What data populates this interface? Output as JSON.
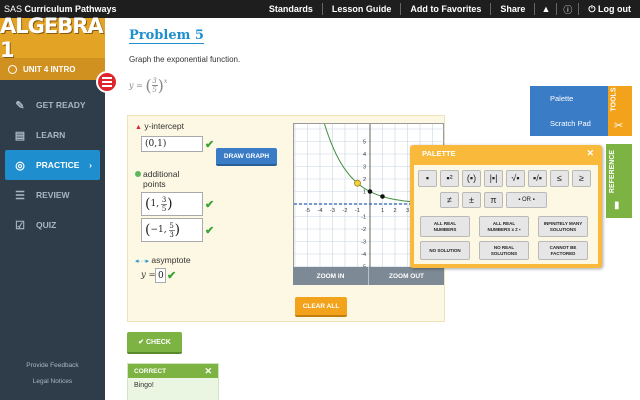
{
  "topbar": {
    "brand_prefix": "SAS",
    "brand_name": "Curriculum Pathways",
    "links": [
      "Standards",
      "Lesson Guide",
      "Add to Favorites",
      "Share"
    ],
    "warning_icon": "warning-icon",
    "info_icon": "info-icon",
    "logout": "Log out"
  },
  "sidebar": {
    "logo": "ALGEBRA 1",
    "unit": "UNIT 4  INTRO",
    "items": [
      {
        "label": "GET READY",
        "icon": "pencil-icon"
      },
      {
        "label": "LEARN",
        "icon": "book-icon"
      },
      {
        "label": "PRACTICE",
        "icon": "target-icon"
      },
      {
        "label": "REVIEW",
        "icon": "list-icon"
      },
      {
        "label": "QUIZ",
        "icon": "checkbox-icon"
      }
    ],
    "active": "PRACTICE",
    "footer": [
      "Provide Feedback",
      "Legal Notices"
    ]
  },
  "problem": {
    "title": "Problem 5",
    "instruction": "Graph the exponential function.",
    "eq_lhs": "y =",
    "eq_num": "3",
    "eq_den": "5",
    "eq_exp": "x"
  },
  "work": {
    "yint_label": "y-intercept",
    "yint_value": "(0,1)",
    "draw_graph": "DRAW GRAPH",
    "addl_label_1": "additional",
    "addl_label_2": "points",
    "point1_x": "1,",
    "point1_num": "3",
    "point1_den": "5",
    "point2_x": "−1,",
    "point2_num": "5",
    "point2_den": "3",
    "asym_label": "asymptote",
    "asym_var": "y =",
    "asym_value": "0",
    "clear_all": "CLEAR ALL",
    "check": "CHECK",
    "zoom_in": "ZOOM IN",
    "zoom_out": "ZOOM OUT"
  },
  "graph": {
    "x_ticks": [
      "-5",
      "-4",
      "-3",
      "-2",
      "-1",
      "1",
      "2",
      "3",
      "4"
    ],
    "y_ticks": [
      "5",
      "4",
      "3",
      "2",
      "1",
      "-1",
      "-2",
      "-3",
      "-4",
      "-5"
    ]
  },
  "feedback": {
    "header": "CORRECT",
    "body": "Bingo!"
  },
  "tools": {
    "tab": "TOOLS",
    "items": [
      "Palette",
      "Scratch Pad"
    ],
    "reference_tab": "REFERENCE"
  },
  "palette": {
    "title": "PALETTE",
    "row1": [
      "▪",
      "▪²",
      "(▪)",
      "|▪|",
      "√▪",
      "▪/▪",
      "≤",
      "≥"
    ],
    "row2": [
      "≠",
      "±",
      "π",
      "▪ OR ▪"
    ],
    "row3": [
      "ALL REAL NUMBERS",
      "ALL REAL NUMBERS x ≠ ▪",
      "INFINITELY MANY SOLUTIONS"
    ],
    "row4": [
      "NO SOLUTION",
      "NO REAL SOLUTIONS",
      "CANNOT BE FACTORED"
    ]
  },
  "colors": {
    "accent_blue": "#1e8ece",
    "logo_gold": "#e3a425",
    "correct_green": "#7cb342",
    "sidebar_bg": "#2f3d4a"
  }
}
